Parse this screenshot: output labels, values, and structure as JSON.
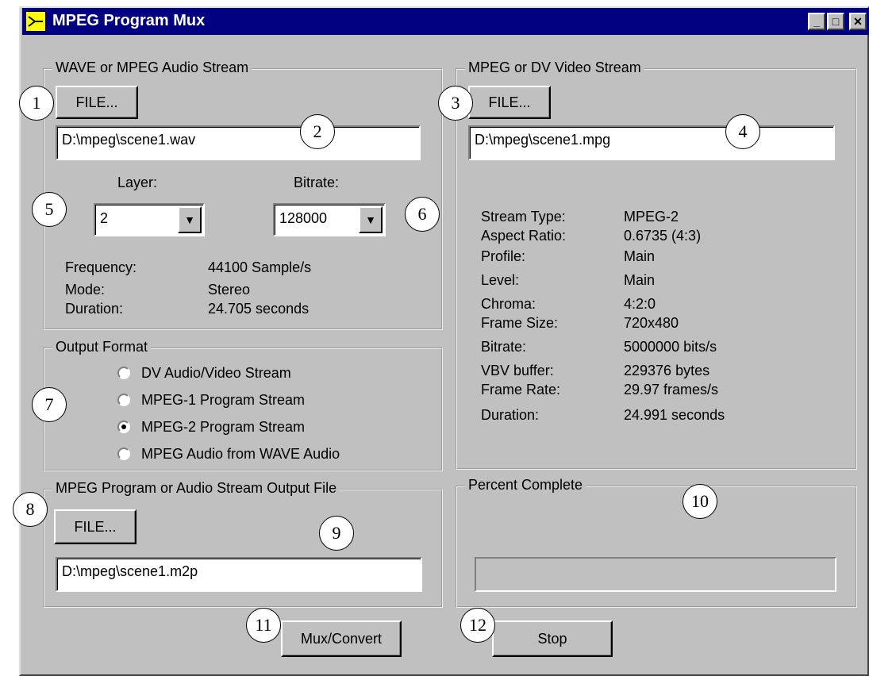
{
  "window": {
    "title": "MPEG Program Mux",
    "minimize_glyph": "_",
    "maximize_glyph": "□",
    "close_glyph": "✕"
  },
  "audio": {
    "legend": "WAVE or MPEG Audio Stream",
    "file_button": "FILE...",
    "file_path": "D:\\mpeg\\scene1.wav",
    "layer_label": "Layer:",
    "layer_value": "2",
    "bitrate_label": "Bitrate:",
    "bitrate_value": "128000",
    "info": [
      {
        "label": "Frequency:",
        "value": "44100 Sample/s"
      },
      {
        "label": "Mode:",
        "value": "Stereo"
      },
      {
        "label": "Duration:",
        "value": "24.705 seconds"
      }
    ]
  },
  "video": {
    "legend": "MPEG or DV Video Stream",
    "file_button": "FILE...",
    "file_path": "D:\\mpeg\\scene1.mpg",
    "info": [
      {
        "label": "Stream Type:",
        "value": "MPEG-2"
      },
      {
        "label": "Aspect Ratio:",
        "value": "0.6735 (4:3)"
      },
      {
        "label": "Profile:",
        "value": "Main"
      },
      {
        "label": "Level:",
        "value": "Main"
      },
      {
        "label": "Chroma:",
        "value": "4:2:0"
      },
      {
        "label": "Frame Size:",
        "value": "720x480"
      },
      {
        "label": "Bitrate:",
        "value": "5000000 bits/s"
      },
      {
        "label": "VBV buffer:",
        "value": "229376 bytes"
      },
      {
        "label": "Frame Rate:",
        "value": "29.97 frames/s"
      },
      {
        "label": "Duration:",
        "value": "24.991 seconds"
      }
    ]
  },
  "output_format": {
    "legend": "Output Format",
    "options": [
      {
        "label": "DV Audio/Video Stream",
        "selected": false
      },
      {
        "label": "MPEG-1 Program Stream",
        "selected": false
      },
      {
        "label": "MPEG-2 Program Stream",
        "selected": true
      },
      {
        "label": "MPEG Audio from WAVE Audio",
        "selected": false
      }
    ]
  },
  "output_file": {
    "legend": "MPEG Program or Audio Stream Output File",
    "file_button": "FILE...",
    "file_path": "D:\\mpeg\\scene1.m2p"
  },
  "progress": {
    "legend": "Percent Complete",
    "value": 0
  },
  "actions": {
    "mux_label": "Mux/Convert",
    "stop_label": "Stop"
  },
  "callouts": [
    "1",
    "2",
    "3",
    "4",
    "5",
    "6",
    "7",
    "8",
    "9",
    "10",
    "11",
    "12"
  ],
  "colors": {
    "titlebar": "#000080",
    "face": "#c0c0c0",
    "icon": "#ffff00"
  }
}
